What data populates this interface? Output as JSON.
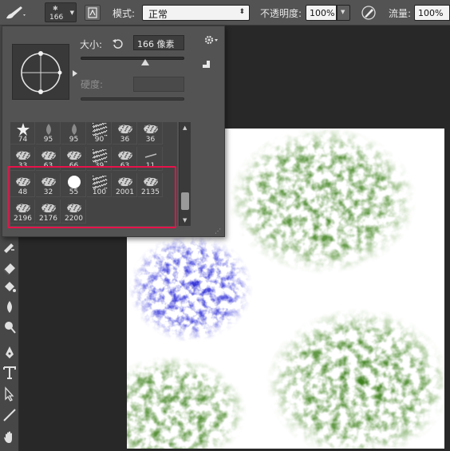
{
  "options_bar": {
    "brush_size": "166",
    "mode_label": "模式:",
    "mode_value": "正常",
    "opacity_label": "不透明度:",
    "opacity_value": "100%",
    "flow_label": "流量:",
    "flow_value": "100%"
  },
  "brush_panel": {
    "size_label": "大小:",
    "size_value": "166 像素",
    "hardness_label": "硬度:",
    "size_slider_fraction": 0.62,
    "presets_rows": [
      [
        "74",
        "95",
        "95",
        "90",
        "36",
        "36"
      ],
      [
        "33",
        "63",
        "66",
        "39",
        "63",
        "11"
      ],
      [
        "48",
        "32",
        "55",
        "100",
        "2001",
        "2135"
      ],
      [
        "2196",
        "2176",
        "2200"
      ]
    ]
  },
  "colors": {
    "panel_bg": "#535353",
    "highlight": "#e8124a",
    "green_paint": "#3a7a1a",
    "blue_paint": "#3a3ad8"
  }
}
